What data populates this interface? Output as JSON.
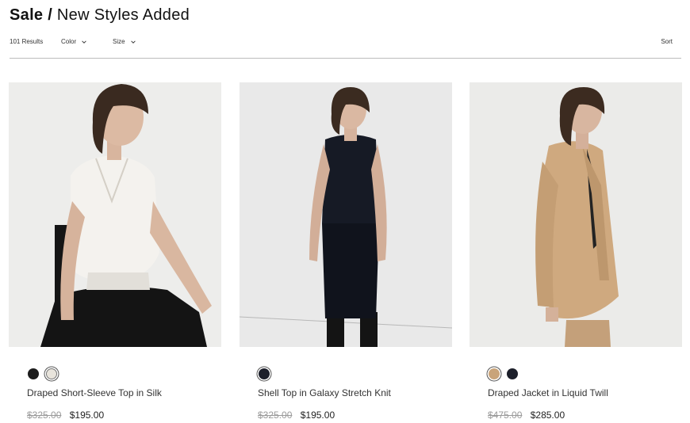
{
  "header": {
    "title_bold": "Sale /",
    "title_rest": "New Styles Added"
  },
  "filters": {
    "results": "101 Results",
    "color_label": "Color",
    "size_label": "Size",
    "sort_label": "Sort",
    "chevron_icon": "chevron-down-icon"
  },
  "products": [
    {
      "name": "Draped Short-Sleeve Top in Silk",
      "original_price": "$325.00",
      "sale_price": "$195.00",
      "image": "model-white-silk-top",
      "swatches": [
        {
          "color": "#1c1c1c",
          "selected": false
        },
        {
          "color": "#e8e4dc",
          "selected": true
        }
      ]
    },
    {
      "name": "Shell Top in Galaxy Stretch Knit",
      "original_price": "$325.00",
      "sale_price": "$195.00",
      "image": "model-black-knit-top",
      "swatches": [
        {
          "color": "#1c1f2a",
          "selected": true
        }
      ]
    },
    {
      "name": "Draped Jacket in Liquid Twill",
      "original_price": "$475.00",
      "sale_price": "$285.00",
      "image": "model-camel-jacket",
      "swatches": [
        {
          "color": "#c9a47a",
          "selected": true
        },
        {
          "color": "#1c1f2a",
          "selected": false
        }
      ]
    }
  ]
}
